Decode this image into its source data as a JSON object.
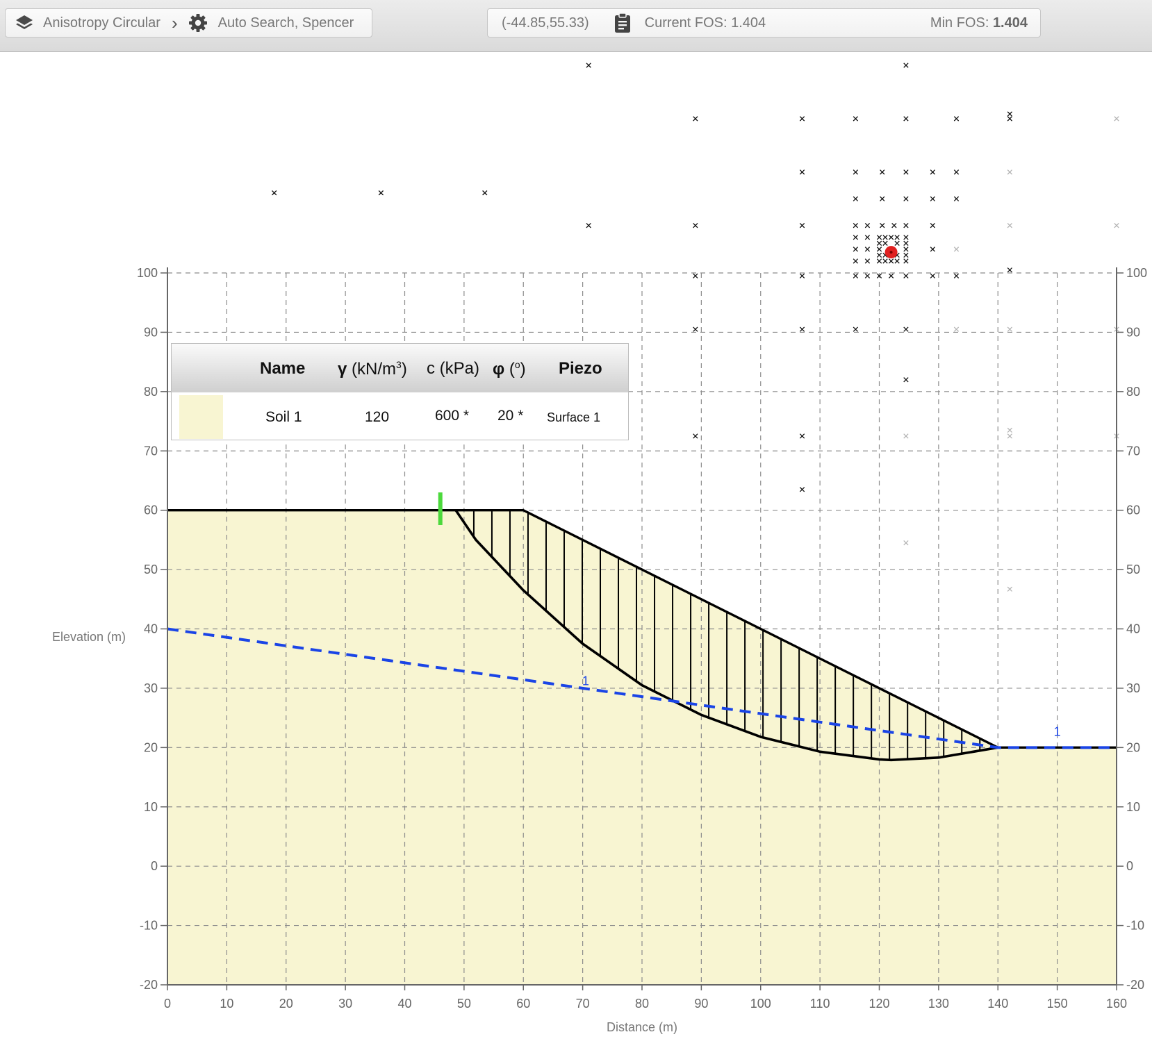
{
  "breadcrumb": {
    "model_label": "Anisotropy Circular",
    "model_icon": "layers-icon",
    "separator": "›",
    "analysis_label": "Auto Search, Spencer",
    "analysis_icon": "gear-icon"
  },
  "status": {
    "coordinates": "(-44.85,55.33)",
    "clipboard_icon": "clipboard-icon",
    "current_fos_label": "Current FOS: 1.404",
    "min_fos_prefix": "Min FOS: ",
    "min_fos_value": "1.404"
  },
  "legend": {
    "headers": {
      "name": "Name",
      "gamma_symbol": "γ",
      "gamma_unit": " (kN/m",
      "gamma_exp": "3",
      "gamma_close": ")",
      "cohesion": "c (kPa)",
      "phi_symbol": "φ",
      "phi_unit_open": " (",
      "phi_deg": "o",
      "phi_unit_close": ")",
      "piezo": "Piezo"
    },
    "rows": [
      {
        "swatch_color": "#f8f5d2",
        "name": "Soil 1",
        "gamma": "120",
        "cohesion": "600 *",
        "phi": "20 *",
        "piezo": "Surface 1"
      }
    ]
  },
  "chart_data": {
    "type": "scatter",
    "xlabel": "Distance (m)",
    "ylabel": "Elevation (m)",
    "xlim": [
      0,
      160
    ],
    "ylim": [
      -20,
      100
    ],
    "x_ticks": [
      0,
      10,
      20,
      30,
      40,
      50,
      60,
      70,
      80,
      90,
      100,
      110,
      120,
      130,
      140,
      150,
      160
    ],
    "y_ticks": [
      -20,
      -10,
      0,
      10,
      20,
      30,
      40,
      50,
      60,
      70,
      80,
      90,
      100
    ],
    "grid": true,
    "colors": {
      "soil": "#f8f5d2",
      "piezo_line": "#1a44e6",
      "critical_center": "#e02020",
      "marker": "#4cd93c"
    },
    "ground_surface": {
      "x": [
        0,
        60,
        140,
        160
      ],
      "y": [
        60,
        60,
        20,
        20
      ]
    },
    "piezometric_line": {
      "name": "1",
      "x": [
        0,
        140,
        160
      ],
      "y": [
        40,
        20,
        20
      ],
      "label_positions": [
        [
          70.5,
          30.5
        ],
        [
          150,
          22
        ]
      ]
    },
    "failure_surface": {
      "x": [
        48.6,
        52,
        60,
        70,
        80,
        90,
        100,
        110,
        120,
        122,
        130,
        140
      ],
      "y": [
        60,
        55,
        46.5,
        37.5,
        30.5,
        25.5,
        21.8,
        19.3,
        18,
        17.9,
        18.3,
        20
      ]
    },
    "slice_count": 30,
    "critical_center": {
      "x": 122,
      "y": 103.5
    },
    "marker": {
      "x": 46,
      "y_range": [
        57.5,
        63
      ]
    },
    "grid_points": [
      {
        "x": 71,
        "y": 135
      },
      {
        "x": 124.5,
        "y": 135
      },
      {
        "x": 89,
        "y": 126
      },
      {
        "x": 107,
        "y": 126
      },
      {
        "x": 116,
        "y": 126
      },
      {
        "x": 124.5,
        "y": 126
      },
      {
        "x": 133,
        "y": 126
      },
      {
        "x": 142,
        "y": 126
      },
      {
        "x": 142,
        "y": 126.8
      },
      {
        "x": 107,
        "y": 117
      },
      {
        "x": 116,
        "y": 117
      },
      {
        "x": 120.5,
        "y": 117
      },
      {
        "x": 124.5,
        "y": 117
      },
      {
        "x": 129,
        "y": 117
      },
      {
        "x": 133,
        "y": 117
      },
      {
        "x": 116,
        "y": 112.5
      },
      {
        "x": 120.5,
        "y": 112.5
      },
      {
        "x": 124.5,
        "y": 112.5
      },
      {
        "x": 129,
        "y": 112.5
      },
      {
        "x": 133,
        "y": 112.5
      },
      {
        "x": 18,
        "y": 113.5
      },
      {
        "x": 36,
        "y": 113.5
      },
      {
        "x": 53.5,
        "y": 113.5
      },
      {
        "x": 71,
        "y": 108
      },
      {
        "x": 89,
        "y": 108
      },
      {
        "x": 107,
        "y": 108
      },
      {
        "x": 116,
        "y": 108
      },
      {
        "x": 118,
        "y": 108
      },
      {
        "x": 120.5,
        "y": 108
      },
      {
        "x": 122.5,
        "y": 108
      },
      {
        "x": 124.5,
        "y": 108
      },
      {
        "x": 129,
        "y": 108
      },
      {
        "x": 116,
        "y": 106
      },
      {
        "x": 118,
        "y": 106
      },
      {
        "x": 120,
        "y": 106
      },
      {
        "x": 121,
        "y": 106
      },
      {
        "x": 122,
        "y": 106
      },
      {
        "x": 123,
        "y": 106
      },
      {
        "x": 124.5,
        "y": 106
      },
      {
        "x": 120,
        "y": 105
      },
      {
        "x": 121,
        "y": 105
      },
      {
        "x": 123,
        "y": 105
      },
      {
        "x": 124.5,
        "y": 105
      },
      {
        "x": 116,
        "y": 104
      },
      {
        "x": 118,
        "y": 104
      },
      {
        "x": 120,
        "y": 104
      },
      {
        "x": 124.5,
        "y": 104
      },
      {
        "x": 129,
        "y": 104
      },
      {
        "x": 120,
        "y": 103
      },
      {
        "x": 121,
        "y": 103
      },
      {
        "x": 123,
        "y": 103
      },
      {
        "x": 124.5,
        "y": 103
      },
      {
        "x": 116,
        "y": 102
      },
      {
        "x": 118,
        "y": 102
      },
      {
        "x": 120,
        "y": 102
      },
      {
        "x": 121,
        "y": 102
      },
      {
        "x": 122,
        "y": 102
      },
      {
        "x": 123,
        "y": 102
      },
      {
        "x": 124.5,
        "y": 102
      },
      {
        "x": 116,
        "y": 99.5
      },
      {
        "x": 118,
        "y": 99.5
      },
      {
        "x": 120,
        "y": 99.5
      },
      {
        "x": 122,
        "y": 99.5
      },
      {
        "x": 124.5,
        "y": 99.5
      },
      {
        "x": 129,
        "y": 99.5
      },
      {
        "x": 133,
        "y": 99.5
      },
      {
        "x": 89,
        "y": 99.5
      },
      {
        "x": 107,
        "y": 99.5
      },
      {
        "x": 142,
        "y": 100.5
      },
      {
        "x": 89,
        "y": 90.5
      },
      {
        "x": 107,
        "y": 90.5
      },
      {
        "x": 116,
        "y": 90.5
      },
      {
        "x": 124.5,
        "y": 90.5
      },
      {
        "x": 124.5,
        "y": 82
      },
      {
        "x": 89,
        "y": 72.5
      },
      {
        "x": 107,
        "y": 72.5
      },
      {
        "x": 107,
        "y": 63.5
      }
    ],
    "grid_points_grey": [
      {
        "x": 160,
        "y": 126
      },
      {
        "x": 142,
        "y": 117
      },
      {
        "x": 142,
        "y": 108
      },
      {
        "x": 160,
        "y": 108
      },
      {
        "x": 133,
        "y": 104
      },
      {
        "x": 133,
        "y": 90.5
      },
      {
        "x": 142,
        "y": 90.5
      },
      {
        "x": 160,
        "y": 90.5
      },
      {
        "x": 142,
        "y": 73.5
      },
      {
        "x": 142,
        "y": 72.5
      },
      {
        "x": 124.5,
        "y": 72.5
      },
      {
        "x": 160,
        "y": 72.5
      },
      {
        "x": 124.5,
        "y": 54.5
      },
      {
        "x": 142,
        "y": 46.7
      }
    ]
  }
}
